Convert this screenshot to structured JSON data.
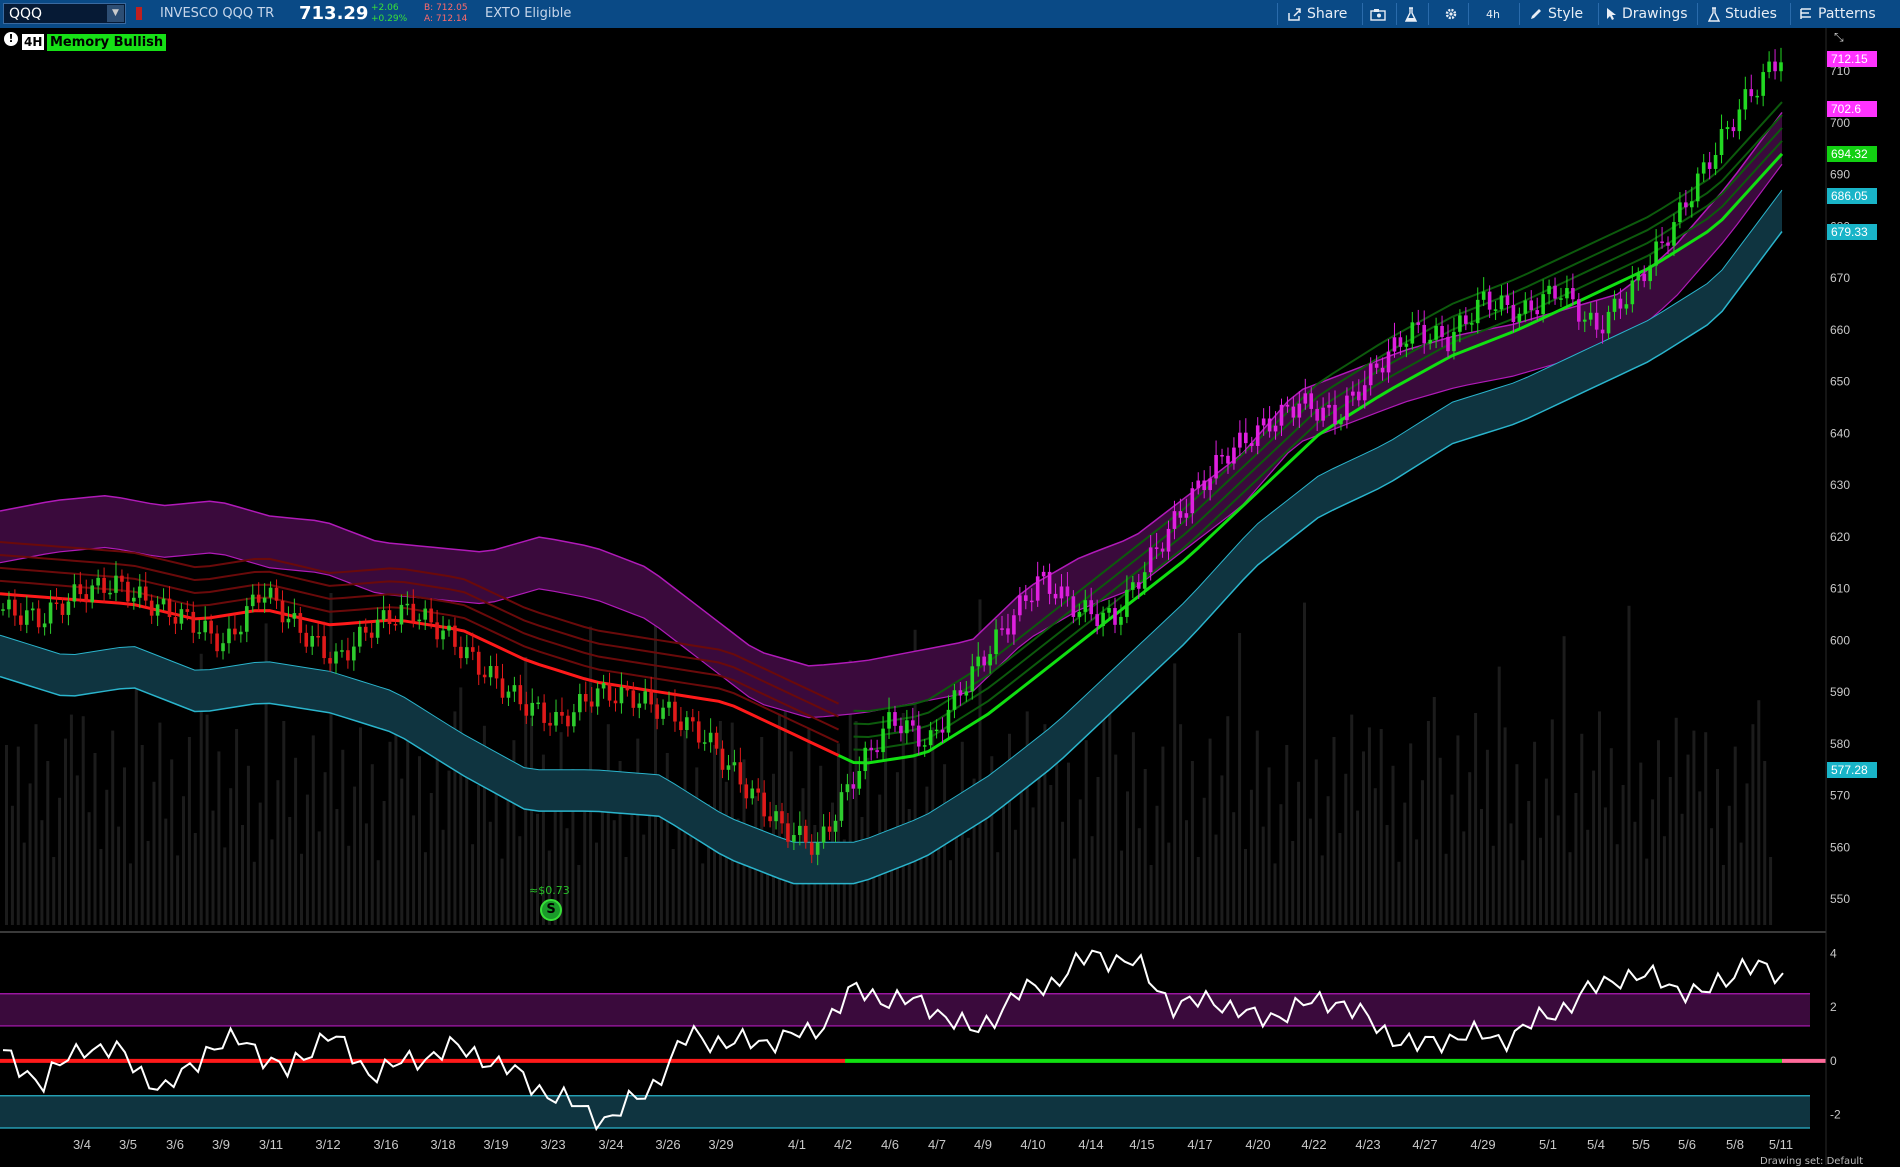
{
  "symbol_input": "QQQ",
  "instrument_name": "INVESCO QQQ TR",
  "last_price": "713.29",
  "net_change": "+2.06",
  "pct_change": "+0.29%",
  "bid": "B: 712.05",
  "ask": "A: 712.14",
  "exto": "EXTO Eligible",
  "toolbar": {
    "share": "Share",
    "aggregation": "4h",
    "style": "Style",
    "drawings": "Drawings",
    "studies": "Studies",
    "patterns": "Patterns"
  },
  "chart_badges": {
    "timeframe": "4H",
    "study": "Memory Bullish"
  },
  "dividend_label": "≈$0.73",
  "footer_text": "Drawing set: Default",
  "price_axis": {
    "ticks": [
      "710",
      "700",
      "690",
      "680",
      "670",
      "660",
      "650",
      "640",
      "630",
      "620",
      "610",
      "600",
      "590",
      "580",
      "570",
      "560",
      "550"
    ]
  },
  "osc_axis": {
    "ticks": [
      "4",
      "2",
      "0",
      "-2"
    ]
  },
  "price_tags": [
    {
      "value": "712.15",
      "color": "#ff33ff"
    },
    {
      "value": "702.6",
      "color": "#ff33ff"
    },
    {
      "value": "694.32",
      "color": "#12d012"
    },
    {
      "value": "686.05",
      "color": "#19b4c8"
    },
    {
      "value": "679.33",
      "color": "#19b4c8"
    },
    {
      "value": "577.28",
      "color": "#19b4c8"
    }
  ],
  "chart_data": {
    "type": "candlestick",
    "symbol": "QQQ",
    "timeframe": "4H",
    "ylim": [
      545,
      716
    ],
    "x_labels": [
      "3/4",
      "3/5",
      "3/6",
      "3/9",
      "3/11",
      "3/12",
      "3/16",
      "3/18",
      "3/19",
      "3/23",
      "3/24",
      "3/26",
      "3/29",
      "4/1",
      "4/2",
      "4/6",
      "4/7",
      "4/9",
      "4/10",
      "4/14",
      "4/15",
      "4/17",
      "4/20",
      "4/22",
      "4/23",
      "4/27",
      "4/29",
      "5/1",
      "5/4",
      "5/5",
      "5/6",
      "5/8",
      "5/11"
    ],
    "close_path": [
      606,
      604,
      609,
      611,
      607,
      604,
      599,
      610,
      602,
      596,
      603,
      606,
      601,
      594,
      588,
      584,
      590,
      589,
      586,
      581,
      572,
      564,
      560,
      574,
      585,
      580,
      592,
      602,
      612,
      606,
      604,
      616,
      627,
      636,
      641,
      646,
      643,
      652,
      660,
      658,
      666,
      663,
      668,
      660,
      668,
      679,
      692,
      704,
      713
    ],
    "upper_band": [
      625,
      627,
      628,
      626,
      627,
      624,
      623,
      619,
      618,
      617,
      620,
      618,
      614,
      606,
      598,
      595,
      596,
      598,
      600,
      610,
      616,
      620,
      628,
      636,
      648,
      652,
      656,
      659,
      661,
      664,
      667,
      676,
      688,
      702
    ],
    "middle_line": [
      609,
      608,
      607,
      604,
      606,
      603,
      604,
      602,
      596,
      592,
      590,
      588,
      582,
      576,
      578,
      586,
      596,
      606,
      616,
      628,
      640,
      648,
      655,
      660,
      666,
      672,
      680,
      694
    ],
    "lower_band": [
      593,
      589,
      591,
      586,
      588,
      586,
      582,
      574,
      567,
      567,
      566,
      558,
      553,
      553,
      558,
      566,
      576,
      588,
      600,
      614,
      624,
      630,
      638,
      642,
      648,
      654,
      662,
      679
    ],
    "oscillator": {
      "values": [
        0.2,
        -0.8,
        0.6,
        0.2,
        -1.2,
        0.4,
        0.8,
        -0.5,
        1.1,
        -0.4,
        -0.1,
        0.5,
        0.1,
        -0.8,
        -1.6,
        -2.2,
        -1.0,
        1.0,
        0.6,
        0.8,
        1.0,
        2.6,
        2.3,
        2.0,
        1.0,
        2.4,
        3.0,
        4.0,
        3.6,
        2.0,
        2.3,
        1.5,
        2.0,
        2.3,
        1.2,
        0.5,
        1.0,
        0.8,
        1.5,
        2.4,
        3.2,
        3.0,
        2.4,
        3.6,
        3.1
      ],
      "ylim": [
        -2.5,
        4.5
      ],
      "zero_line_bearish_color": "#ff1a1a",
      "zero_line_bullish_color": "#11e011"
    }
  }
}
